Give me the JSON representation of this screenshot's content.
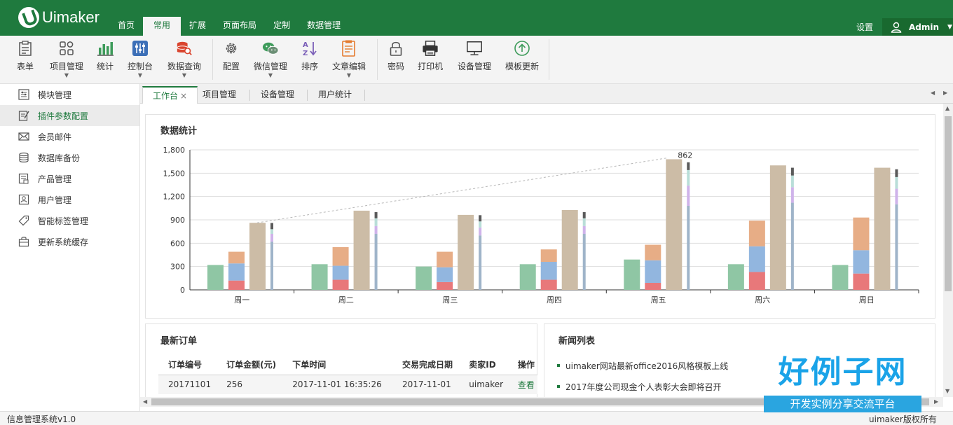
{
  "header": {
    "logo_text": "Uimaker",
    "nav": [
      "首页",
      "常用",
      "扩展",
      "页面布局",
      "定制",
      "数据管理"
    ],
    "active_nav": "常用",
    "settings": "设置",
    "user": "Admin"
  },
  "toolbar": {
    "items": [
      "表单",
      "项目管理",
      "统计",
      "控制台",
      "数据查询",
      "配置",
      "微信管理",
      "排序",
      "文章编辑",
      "密码",
      "打印机",
      "设备管理",
      "模板更新"
    ]
  },
  "sidebar": {
    "items": [
      "模块管理",
      "插件参数配置",
      "会员邮件",
      "数据库备份",
      "产品管理",
      "用户管理",
      "智能标签管理",
      "更新系统缓存"
    ],
    "active_index": 1
  },
  "tabs": [
    "工作台",
    "项目管理",
    "设备管理",
    "用户统计"
  ],
  "stats_panel": {
    "title": "数据统计"
  },
  "chart_data": {
    "type": "bar",
    "categories": [
      "周一",
      "周二",
      "周三",
      "周四",
      "周五",
      "周六",
      "周日"
    ],
    "ylim": [
      0,
      1800
    ],
    "yticks": [
      "0",
      "300",
      "600",
      "900",
      "1,200",
      "1,500",
      "1,800"
    ],
    "series": [
      {
        "values": [
          320,
          330,
          300,
          330,
          390,
          330,
          320
        ],
        "color": "#8fc6a4"
      },
      {
        "stack": [
          {
            "values": [
              120,
              130,
              100,
              130,
              90,
              230,
              210
            ],
            "color": "#e8787a"
          },
          {
            "values": [
              220,
              180,
              190,
              230,
              290,
              330,
              300
            ],
            "color": "#92b6df"
          },
          {
            "values": [
              150,
              240,
              200,
              160,
              200,
              330,
              420
            ],
            "color": "#e7ad86"
          }
        ]
      },
      {
        "values": [
          862,
          1018,
          964,
          1026,
          1679,
          1600,
          1570
        ],
        "color": "#ccbca6"
      },
      {
        "stack": [
          {
            "values": [
              620,
              720,
              700,
              720,
              1080,
              1120,
              1100
            ],
            "color": "#9fb4c9"
          },
          {
            "values": [
              100,
              100,
              100,
              100,
              260,
              200,
              200
            ],
            "color": "#cfb3ea"
          },
          {
            "values": [
              60,
              100,
              80,
              100,
              200,
              150,
              150
            ],
            "color": "#b9ded8"
          },
          {
            "values": [
              80,
              80,
              80,
              80,
              100,
              100,
              100
            ],
            "color": "#5a5a5a"
          }
        ]
      }
    ],
    "annotation": "862",
    "colors": {
      "grid": "#dddddd",
      "axis": "#333333",
      "accent": "#1f7a3e"
    }
  },
  "orders": {
    "title": "最新订单",
    "columns": [
      "订单编号",
      "订单金额(元)",
      "下单时间",
      "交易完成日期",
      "卖家ID",
      "操作"
    ],
    "rows": [
      [
        "20171101",
        "256",
        "2017-11-01 16:35:26",
        "2017-11-01",
        "uimaker",
        "查看"
      ]
    ]
  },
  "news": {
    "title": "新闻列表",
    "items": [
      "uimaker网站最新office2016风格模板上线",
      "2017年度公司现金个人表彰大会即将召开"
    ]
  },
  "footer": {
    "left": "信息管理系统v1.0",
    "right": "uimaker版权所有"
  },
  "watermark": {
    "big": "好例子网",
    "small": "开发实例分享交流平台"
  }
}
